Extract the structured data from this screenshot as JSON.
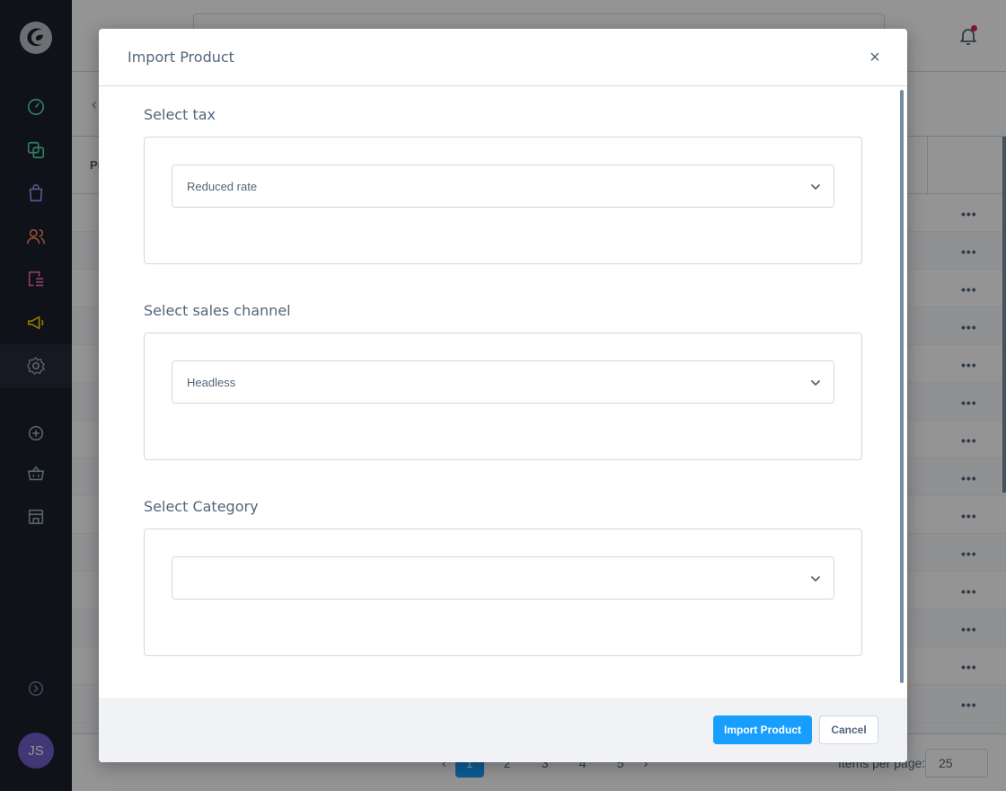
{
  "sidebar": {
    "user_initials": "JS",
    "items": [
      {
        "icon": "dashboard-icon",
        "color": "#57d9a3"
      },
      {
        "icon": "catalogue-icon",
        "color": "#57d9a3"
      },
      {
        "icon": "orders-icon",
        "color": "#a092f0"
      },
      {
        "icon": "customers-icon",
        "color": "#f88962"
      },
      {
        "icon": "content-icon",
        "color": "#ff68b4"
      },
      {
        "icon": "marketing-icon",
        "color": "#ffd700"
      },
      {
        "icon": "settings-icon",
        "color": "#9aa8b5"
      },
      {
        "icon": "add-icon",
        "color": "#9aa8b5"
      },
      {
        "icon": "basket-icon",
        "color": "#9aa8b5"
      },
      {
        "icon": "store-icon",
        "color": "#9aa8b5"
      },
      {
        "icon": "collapse-icon",
        "color": "#9aa8b5"
      }
    ]
  },
  "background": {
    "column_label": "Pr",
    "pagination": {
      "pages": [
        "1",
        "2",
        "3",
        "4",
        "5"
      ],
      "current": "1",
      "items_per_page_label": "Items per page:",
      "items_per_page_value": "25"
    }
  },
  "modal": {
    "title": "Import Product",
    "close_label": "×",
    "sections": [
      {
        "label": "Select tax",
        "value": "Reduced rate"
      },
      {
        "label": "Select sales channel",
        "value": "Headless"
      },
      {
        "label": "Select Category",
        "value": ""
      }
    ],
    "primary_button": "Import Product",
    "secondary_button": "Cancel"
  },
  "colors": {
    "accent": "#189eff",
    "sidebar_bg": "#1b1f2b",
    "text": "#52667a",
    "border": "#d1d9e0"
  }
}
